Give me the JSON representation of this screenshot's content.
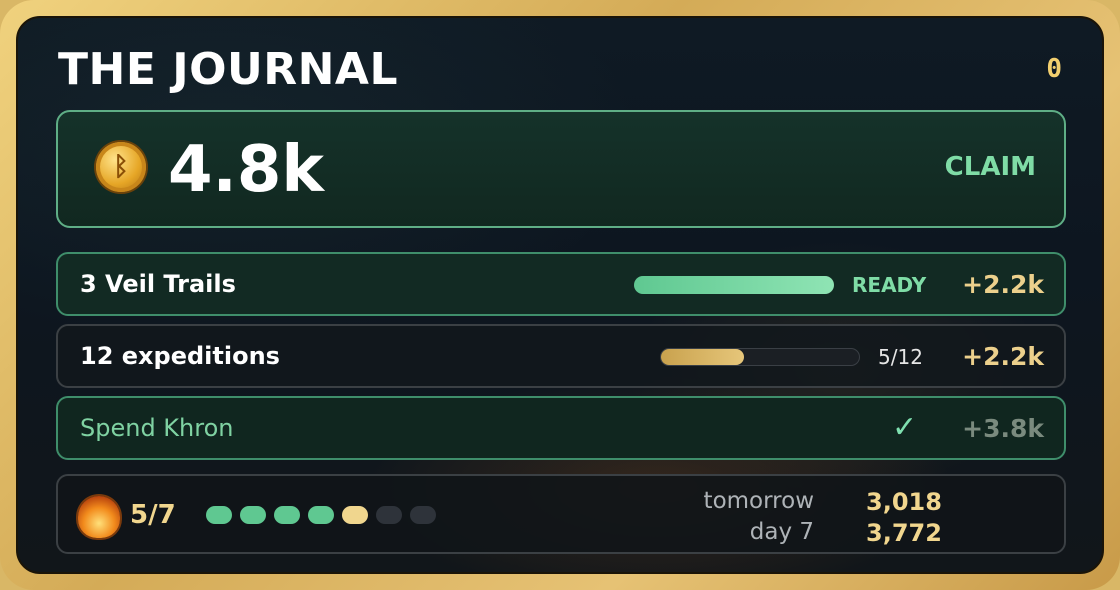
{
  "journal": {
    "title": "THE JOURNAL",
    "counter": "0",
    "balance": "4.8k",
    "claim_label": "CLAIM",
    "coin_icon": "khron-coin-icon"
  },
  "tasks": [
    {
      "label": "3 Veil Trails",
      "status": "READY",
      "progress": 1.0,
      "reward": "+2.2k",
      "state": "ready"
    },
    {
      "label": "12 expeditions",
      "status": "5/12",
      "progress": 0.4167,
      "reward": "+2.2k",
      "state": "in-progress"
    },
    {
      "label": "Spend Khron",
      "status": "✓",
      "progress": 1.0,
      "reward": "+3.8k",
      "state": "claimed"
    }
  ],
  "streak": {
    "icon": "flame-icon",
    "count": "5/7",
    "days_total": 7,
    "days_done": 4,
    "today_index": 5,
    "tomorrow_label": "tomorrow",
    "tomorrow_value": "3,018",
    "day7_label": "day 7",
    "day7_value": "3,772"
  },
  "colors": {
    "accent_green": "#7fdca6",
    "gold": "#ecd08c",
    "bar_green": "#6fd49b",
    "bar_gold": "#d9b25e",
    "pip_green": "#5fc891",
    "pip_today": "#f0d68e",
    "pip_empty": "#2e333a"
  }
}
